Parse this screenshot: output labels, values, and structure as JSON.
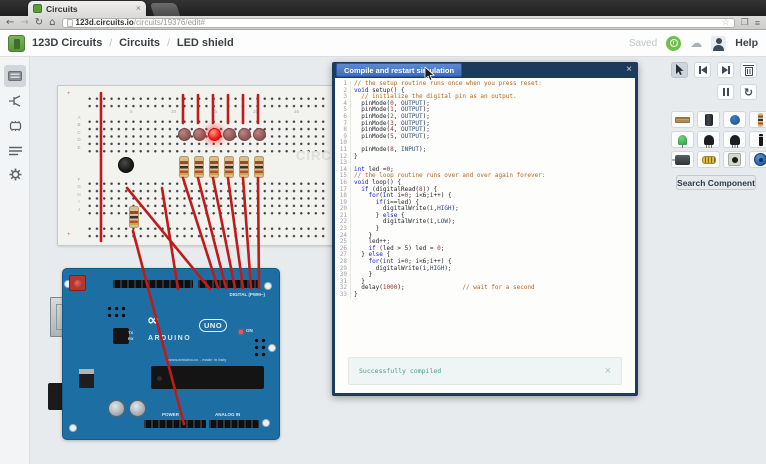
{
  "browser": {
    "tab_title": "Circuits",
    "url_host": "123d.circuits.io",
    "url_path": "/circuits/19376/edit#"
  },
  "header": {
    "brand": "123D Circuits",
    "separator": "/",
    "breadcrumbs": [
      "Circuits",
      "LED shield"
    ],
    "saved_label": "Saved",
    "help_label": "Help"
  },
  "sidebar": {
    "items": [
      {
        "name": "breadboard-view",
        "selected": true
      },
      {
        "name": "schematic-view",
        "selected": false
      },
      {
        "name": "pcb-view",
        "selected": false
      },
      {
        "name": "component-list",
        "selected": false
      },
      {
        "name": "settings",
        "selected": false
      }
    ]
  },
  "editor": {
    "title_button": "Compile and restart simulation",
    "close_label": "×",
    "status_message": "Successfully compiled",
    "status_close": "×",
    "code_lines": [
      "// the setup routine runs once when you press reset:",
      "void setup() {",
      "  // initialize the digital pin as an output.",
      "  pinMode(0, OUTPUT);",
      "  pinMode(1, OUTPUT);",
      "  pinMode(2, OUTPUT);",
      "  pinMode(3, OUTPUT);",
      "  pinMode(4, OUTPUT);",
      "  pinMode(5, OUTPUT);",
      "",
      "  pinMode(8, INPUT);",
      "}",
      "",
      "int led =0;",
      "// the loop routine runs over and over again forever:",
      "void loop() {",
      "  if (digitalRead(8)) {",
      "    for(int i=0; i<6;i++) {",
      "      if(i==led) {",
      "        digitalWrite(i,HIGH);",
      "      } else {",
      "        digitalWrite(i,LOW);",
      "      }",
      "    }",
      "    led++;",
      "    if (led > 5) led = 0;",
      "  } else {",
      "    for(int i=0; i<6;i++) {",
      "      digitalWrite(i,HIGH);",
      "    }",
      "  }",
      "  delay(1000);                // wait for a second",
      "}"
    ],
    "syntax_colors": {
      "comment": "#b5651d",
      "keyword": "#1a21c6",
      "constant": "#2d4a7a",
      "number": "#9c2f2f"
    }
  },
  "toolbar": {
    "tools": [
      "select",
      "step-back",
      "step-forward",
      "delete",
      "pause",
      "restart"
    ],
    "selected_tool": "select"
  },
  "palette": {
    "items": [
      "breadboard",
      "electrolytic-capacitor",
      "ceramic-capacitor",
      "resistor",
      "green-led",
      "npn-transistor",
      "pnp-transistor",
      "diode",
      "dc-motor",
      "photoresistor",
      "pushbutton",
      "potentiometer"
    ],
    "search_label": "Search Component"
  },
  "breadboard": {
    "row_letters_top": [
      "A",
      "B",
      "C",
      "D",
      "E"
    ],
    "row_letters_bottom": [
      "F",
      "G",
      "H",
      "I",
      "J"
    ],
    "column_numbers": [
      "5",
      "10",
      "15",
      "20",
      "25",
      "30"
    ],
    "plus_sign": "+",
    "watermark": "CIRCUITS",
    "leds": {
      "count": 6,
      "lit_index": 2
    },
    "resistor_count": 6
  },
  "arduino": {
    "digital_label": "DIGITAL (PWM~)",
    "power_label": "POWER",
    "analog_label": "ANALOG IN",
    "brand": "ARDUINO",
    "model": "UNO",
    "infinity": "∞",
    "on_label": "ON",
    "tx_label": "TX",
    "rx_label": "RX",
    "made_label": "www.arduino.cc - made in italy",
    "board_color": "#1d6fa3"
  },
  "colors": {
    "wire_red": "#c11a1a",
    "panel_navy": "#1d3b5c",
    "compile_button_blue": "#4a7cc8",
    "status_teal": "#45a08c",
    "logo_green": "#5d9440"
  }
}
